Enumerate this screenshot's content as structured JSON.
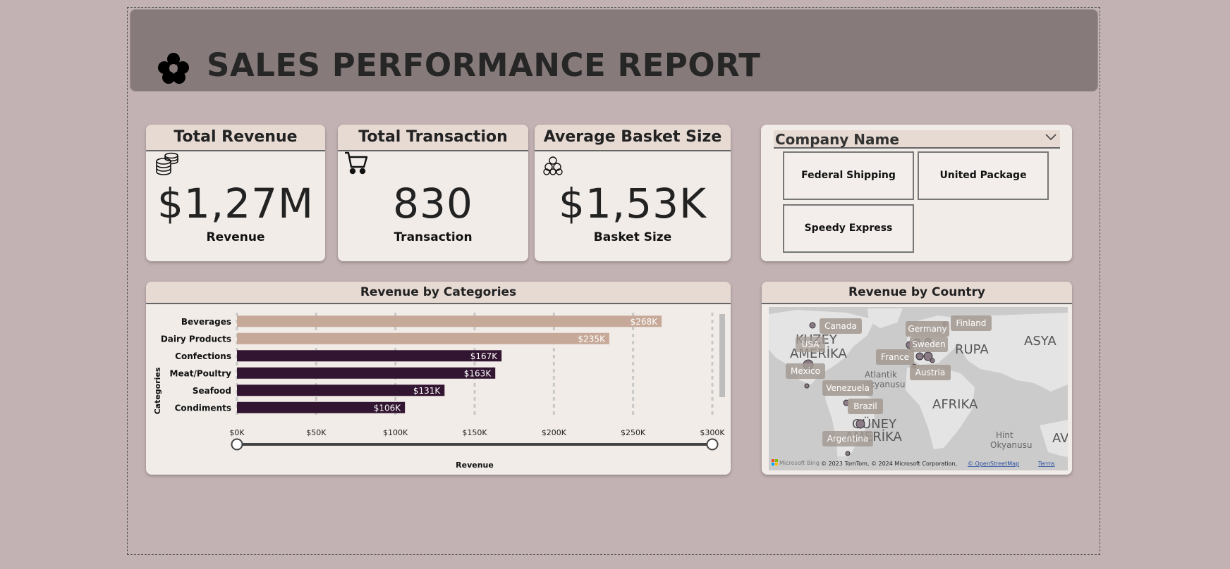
{
  "header": {
    "title": "SALES PERFORMANCE REPORT"
  },
  "kpis": [
    {
      "title": "Total Revenue",
      "value": "$1,27M",
      "label": "Revenue",
      "icon": "coins-icon"
    },
    {
      "title": "Total Transaction",
      "value": "830",
      "label": "Transaction",
      "icon": "cart-icon"
    },
    {
      "title": "Average Basket Size",
      "value": "$1,53K",
      "label": "Basket Size",
      "icon": "basket-icon"
    }
  ],
  "slicer": {
    "title": "Company Name",
    "options": [
      "Federal Shipping",
      "United Package",
      "Speedy Express"
    ]
  },
  "categories_chart": {
    "title": "Revenue by Categories",
    "chart_data": {
      "type": "bar",
      "orientation": "horizontal",
      "title": "Revenue by Categories",
      "xlabel": "Revenue",
      "ylabel": "Categories",
      "categories": [
        "Beverages",
        "Dairy Products",
        "Confections",
        "Meat/Poultry",
        "Seafood",
        "Condiments"
      ],
      "values": [
        268000,
        235000,
        167000,
        163000,
        131000,
        106000
      ],
      "value_labels": [
        "$268K",
        "$235K",
        "$167K",
        "$163K",
        "$131K",
        "$106K"
      ],
      "bar_colors": [
        "#c6a998",
        "#c6a998",
        "#321530",
        "#321530",
        "#321530",
        "#321530"
      ],
      "xlim": [
        0,
        300000
      ],
      "xticks": [
        0,
        50000,
        100000,
        150000,
        200000,
        250000,
        300000
      ],
      "xtick_labels": [
        "$0K",
        "$50K",
        "$100K",
        "$150K",
        "$200K",
        "$250K",
        "$300K"
      ],
      "grid": true
    }
  },
  "map": {
    "title": "Revenue by Country",
    "country_labels": [
      "Canada",
      "USA",
      "Germany",
      "Finland",
      "Sweden",
      "France",
      "Austria",
      "Mexico",
      "Venezuela",
      "Brazil",
      "Argentina"
    ],
    "region_labels": [
      "KUZEY",
      "AMERİKA",
      "ASYA",
      "AVU",
      "AFRIKA",
      "GÜNEY",
      "AMERİKA",
      "RUPA",
      "Atlantik",
      "Okyanusu",
      "Hint",
      "Okyanusu"
    ],
    "attribution": "© 2023 TomTom, © 2024 Microsoft Corporation,",
    "osm_link": "© OpenStreetMap",
    "terms_link": "Terms",
    "bing": "Microsoft Bing"
  },
  "colors": {
    "background": "#c3b2b3",
    "header": "#877a7a",
    "card": "#f1ece8",
    "card_head": "#e6dad3",
    "bar_light": "#c6a998",
    "bar_dark": "#321530"
  }
}
